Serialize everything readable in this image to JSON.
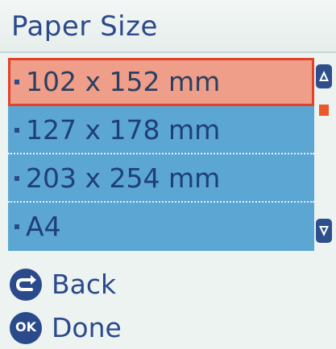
{
  "header": {
    "title": "Paper Size"
  },
  "list": {
    "items": [
      {
        "label": "102 x 152 mm",
        "selected": true
      },
      {
        "label": "127 x 178 mm",
        "selected": false
      },
      {
        "label": "203 x 254 mm",
        "selected": false
      },
      {
        "label": "A4",
        "selected": false
      }
    ]
  },
  "scrollbar": {
    "up_icon": "triangle-up-icon",
    "down_icon": "triangle-down-icon"
  },
  "footer": {
    "back": {
      "icon": "back-arrow-icon",
      "label": "Back"
    },
    "done": {
      "icon": "ok-button-icon",
      "icon_text": "OK",
      "label": "Done"
    }
  },
  "colors": {
    "list_background": "#5ba6d3",
    "selection_fill": "#ef9e8a",
    "selection_border": "#e2412a",
    "text_primary": "#2b4a8c",
    "scroll_thumb": "#e85a2a"
  }
}
